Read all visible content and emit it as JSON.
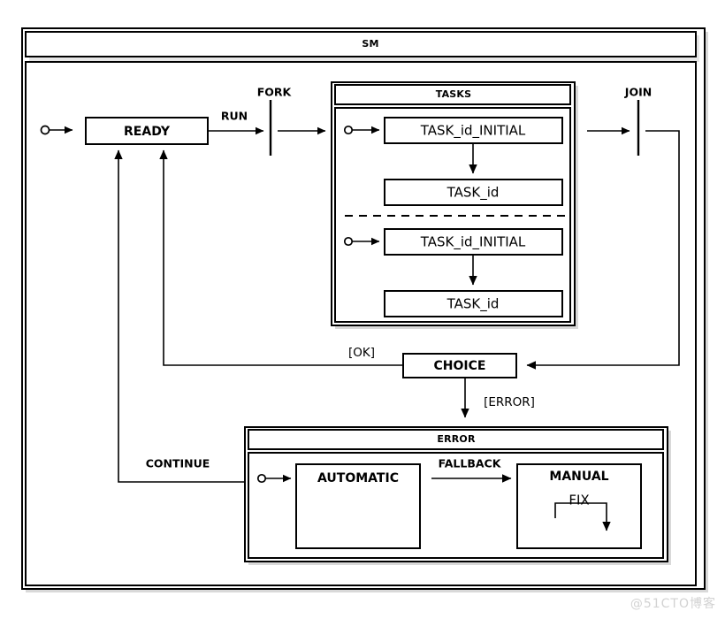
{
  "diagram": {
    "title": "SM",
    "watermark": "@51CTO博客",
    "type": "uml-state-machine"
  },
  "states": {
    "ready": "READY",
    "choice": "CHOICE",
    "tasks_title": "TASKS",
    "task_initial_1": "TASK_id_INITIAL",
    "task_1": "TASK_id",
    "task_initial_2": "TASK_id_INITIAL",
    "task_2": "TASK_id",
    "error_title": "ERROR",
    "automatic": "AUTOMATIC",
    "manual": "MANUAL"
  },
  "nodes": {
    "fork": "FORK",
    "join": "JOIN"
  },
  "transitions": {
    "run": "RUN",
    "ok": "[OK]",
    "error": "[ERROR]",
    "continue": "CONTINUE",
    "fallback": "FALLBACK",
    "fix": "FIX"
  },
  "colors": {
    "stroke": "#000000",
    "background": "#ffffff",
    "shadow": "#d9d9d9",
    "watermark": "#d2d2d2"
  }
}
